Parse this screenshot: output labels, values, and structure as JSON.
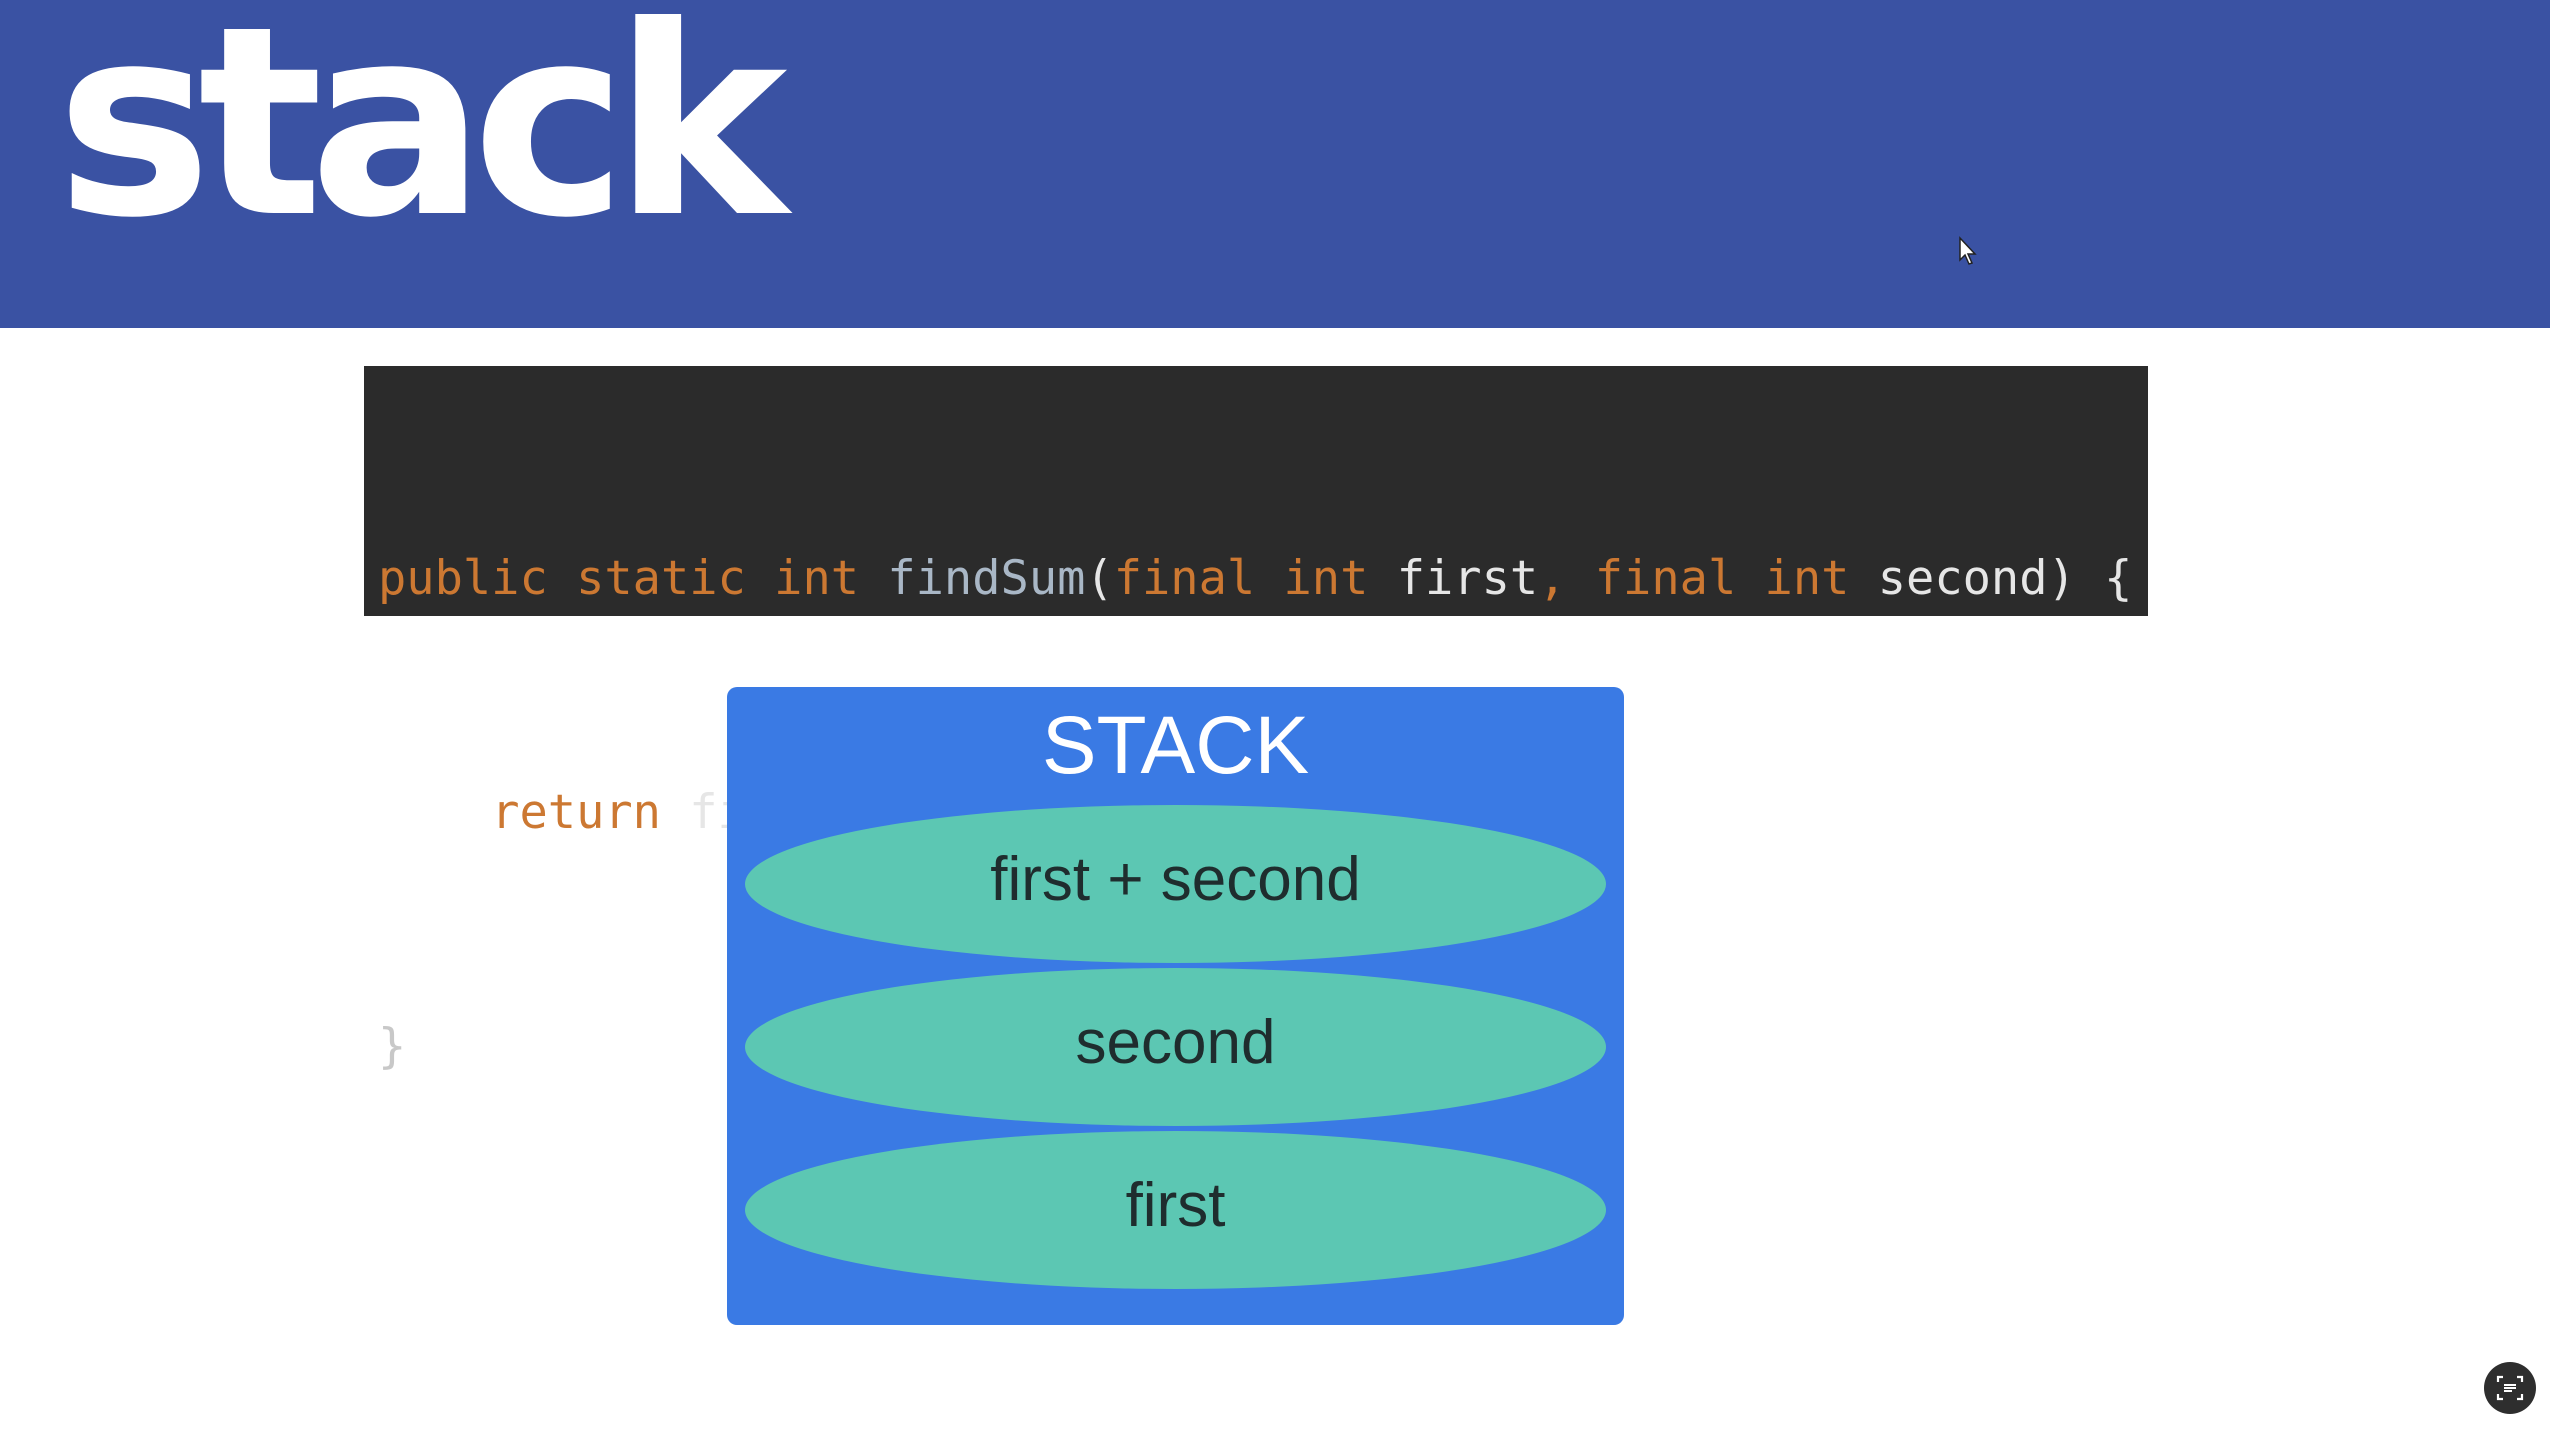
{
  "header": {
    "title": "stack"
  },
  "code": {
    "line1": [
      {
        "t": "public static int ",
        "c": "kw"
      },
      {
        "t": "findSum",
        "c": "fn"
      },
      {
        "t": "(",
        "c": "id"
      },
      {
        "t": "final int ",
        "c": "kw"
      },
      {
        "t": "first",
        "c": "id"
      },
      {
        "t": ", ",
        "c": "punc"
      },
      {
        "t": "final int ",
        "c": "kw"
      },
      {
        "t": "second) {",
        "c": "id"
      }
    ],
    "line2": [
      {
        "t": "    ",
        "c": "id"
      },
      {
        "t": "return ",
        "c": "kw"
      },
      {
        "t": "first + second",
        "c": "id"
      },
      {
        "t": ";",
        "c": "punc"
      }
    ],
    "line3": [
      {
        "t": "}",
        "c": "brace"
      }
    ]
  },
  "diagram": {
    "title": "STACK",
    "items": [
      "first + second",
      "second",
      "first"
    ]
  },
  "colors": {
    "header_bg": "#3a52a3",
    "code_bg": "#2b2b2b",
    "stack_bg": "#3a7ae4",
    "item_bg": "#5cc7b3",
    "keyword": "#cc7832"
  },
  "icons": {
    "cursor": "mouse-pointer-icon",
    "corner": "screen-capture-icon"
  }
}
